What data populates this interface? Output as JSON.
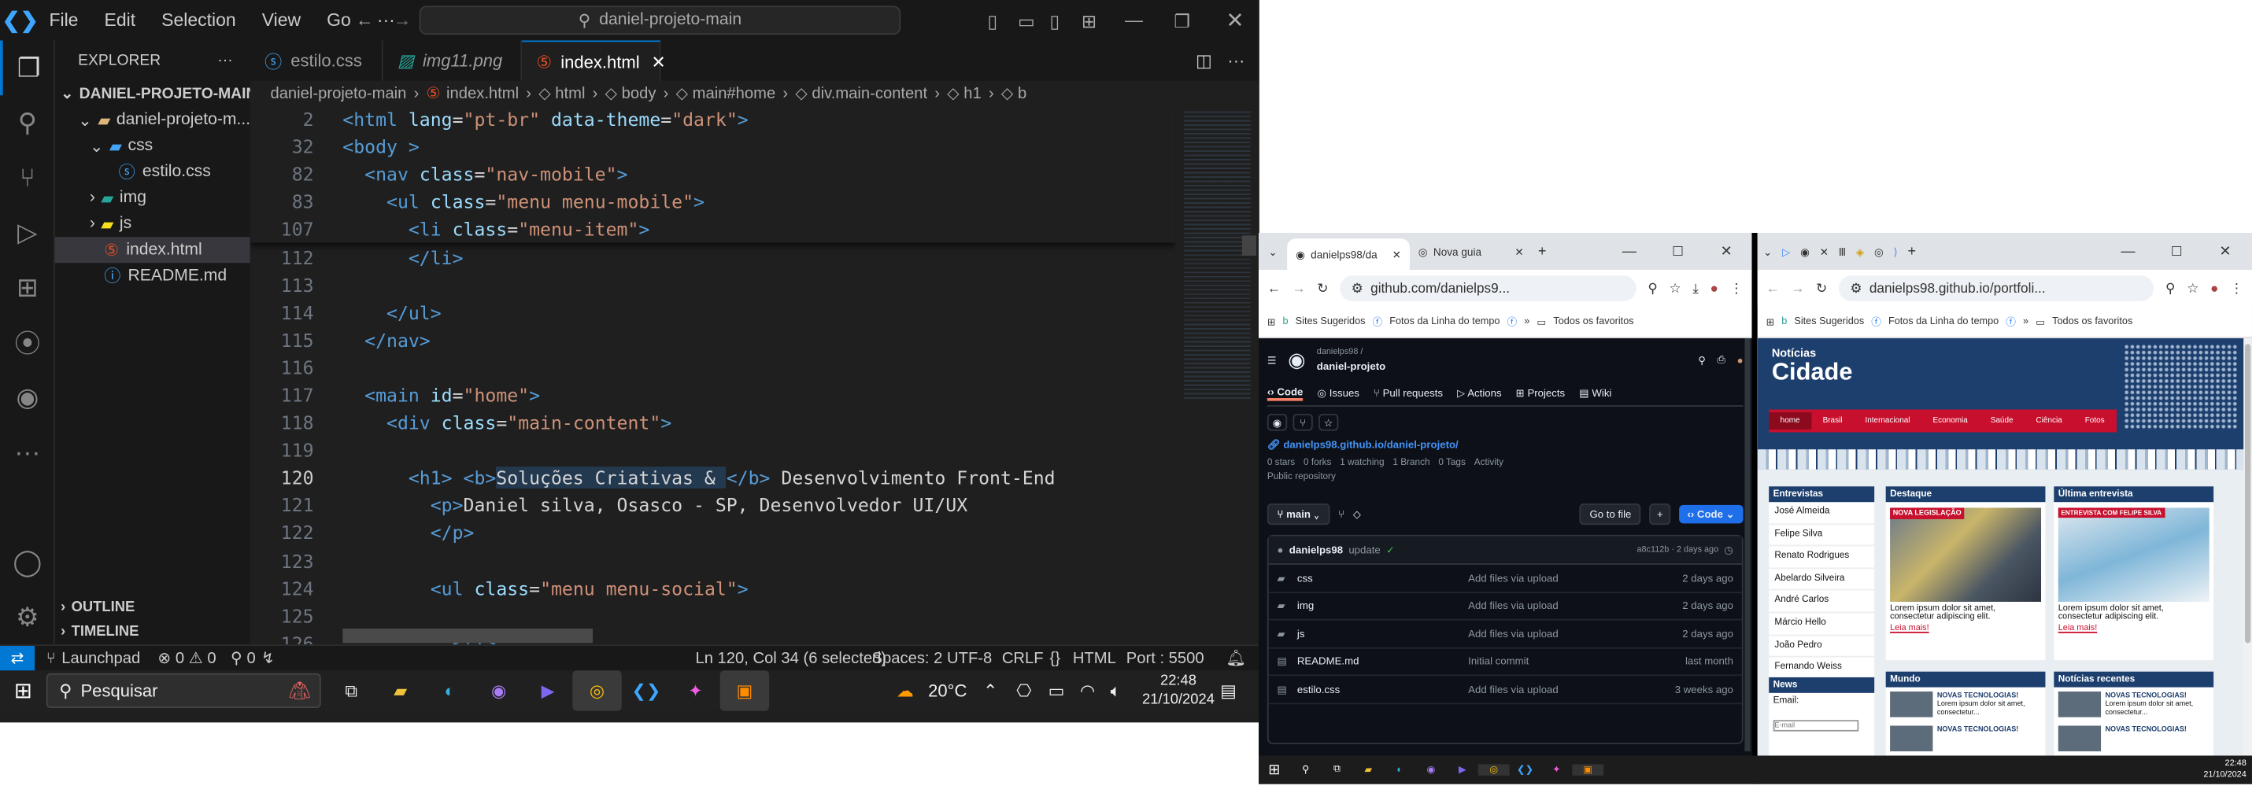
{
  "vscode": {
    "menu": [
      "File",
      "Edit",
      "Selection",
      "View",
      "Go",
      "···"
    ],
    "command_center": "daniel-projeto-main",
    "explorer_title": "EXPLORER",
    "project": "DANIEL-PROJETO-MAIN",
    "tree": [
      {
        "label": "daniel-projeto-m...",
        "level": 1,
        "type": "folder"
      },
      {
        "label": "css",
        "level": 2,
        "type": "folder"
      },
      {
        "label": "estilo.css",
        "level": 3,
        "type": "css"
      },
      {
        "label": "img",
        "level": 2,
        "type": "folder"
      },
      {
        "label": "js",
        "level": 2,
        "type": "folder"
      },
      {
        "label": "index.html",
        "level": 2,
        "type": "html"
      },
      {
        "label": "README.md",
        "level": 2,
        "type": "md"
      }
    ],
    "outline": "OUTLINE",
    "timeline": "TIMELINE",
    "tabs": [
      {
        "label": "estilo.css"
      },
      {
        "label": "img11.png"
      },
      {
        "label": "index.html"
      }
    ],
    "breadcrumb": [
      "daniel-projeto-main",
      "index.html",
      "html",
      "body",
      "main#home",
      "div.main-content",
      "h1",
      "b"
    ],
    "sticky": [
      {
        "n": "2",
        "code": [
          [
            "kw",
            "<html "
          ],
          [
            "at",
            "lang"
          ],
          [
            "tx",
            "="
          ],
          [
            "st",
            "\"pt-br\" "
          ],
          [
            "at",
            "data-theme"
          ],
          [
            "tx",
            "="
          ],
          [
            "st",
            "\"dark\""
          ],
          [
            "kw",
            ">"
          ]
        ]
      },
      {
        "n": "32",
        "code": [
          [
            "kw",
            "<body "
          ],
          [
            "kw",
            ">"
          ]
        ]
      },
      {
        "n": "82",
        "code": [
          [
            "tx",
            "  "
          ],
          [
            "kw",
            "<nav "
          ],
          [
            "at",
            "class"
          ],
          [
            "tx",
            "="
          ],
          [
            "st",
            "\"nav-mobile\""
          ],
          [
            "kw",
            ">"
          ]
        ]
      },
      {
        "n": "83",
        "code": [
          [
            "tx",
            "    "
          ],
          [
            "kw",
            "<ul "
          ],
          [
            "at",
            "class"
          ],
          [
            "tx",
            "="
          ],
          [
            "st",
            "\"menu menu-mobile\""
          ],
          [
            "kw",
            ">"
          ]
        ]
      },
      {
        "n": "107",
        "code": [
          [
            "tx",
            "      "
          ],
          [
            "kw",
            "<li "
          ],
          [
            "at",
            "class"
          ],
          [
            "tx",
            "="
          ],
          [
            "st",
            "\"menu-item\""
          ],
          [
            "kw",
            ">"
          ]
        ]
      }
    ],
    "lines": [
      {
        "n": "112",
        "code": [
          [
            "tx",
            "      "
          ],
          [
            "kw",
            "</li>"
          ]
        ]
      },
      {
        "n": "113",
        "code": []
      },
      {
        "n": "114",
        "code": [
          [
            "tx",
            "    "
          ],
          [
            "kw",
            "</ul>"
          ]
        ]
      },
      {
        "n": "115",
        "code": [
          [
            "tx",
            "  "
          ],
          [
            "kw",
            "</nav>"
          ]
        ]
      },
      {
        "n": "116",
        "code": []
      },
      {
        "n": "117",
        "code": [
          [
            "tx",
            "  "
          ],
          [
            "kw",
            "<main "
          ],
          [
            "at",
            "id"
          ],
          [
            "tx",
            "="
          ],
          [
            "st",
            "\"home\""
          ],
          [
            "kw",
            ">"
          ]
        ]
      },
      {
        "n": "118",
        "code": [
          [
            "tx",
            "    "
          ],
          [
            "kw",
            "<div "
          ],
          [
            "at",
            "class"
          ],
          [
            "tx",
            "="
          ],
          [
            "st",
            "\"main-content\""
          ],
          [
            "kw",
            ">"
          ]
        ]
      },
      {
        "n": "119",
        "code": []
      },
      {
        "n": "120",
        "code": [
          [
            "tx",
            "      "
          ],
          [
            "kw",
            "<h1> "
          ],
          [
            "kw",
            "<b>"
          ],
          [
            "tx",
            "Soluções Criativas & "
          ],
          [
            "kw",
            "</b>"
          ],
          [
            "tx",
            " Desenvolvimento Front-End"
          ]
        ]
      },
      {
        "n": "121",
        "code": [
          [
            "tx",
            "        "
          ],
          [
            "kw",
            "<p>"
          ],
          [
            "tx",
            "Daniel silva, Osasco - SP, Desenvolvedor UI/UX"
          ]
        ]
      },
      {
        "n": "122",
        "code": [
          [
            "tx",
            "        "
          ],
          [
            "kw",
            "</p>"
          ]
        ]
      },
      {
        "n": "123",
        "code": []
      },
      {
        "n": "124",
        "code": [
          [
            "tx",
            "        "
          ],
          [
            "kw",
            "<ul "
          ],
          [
            "at",
            "class"
          ],
          [
            "tx",
            "="
          ],
          [
            "st",
            "\"menu menu-social\""
          ],
          [
            "kw",
            ">"
          ]
        ]
      },
      {
        "n": "125",
        "code": []
      },
      {
        "n": "126",
        "code": [
          [
            "tx",
            "          "
          ],
          [
            "kw",
            "<li>"
          ]
        ]
      }
    ],
    "status": {
      "remote": "⇄",
      "branch": "Launchpad",
      "problems": "⊗ 0 ⚠ 0",
      "ports": "⚲ 0",
      "cursor": "Ln 120, Col 34 (6 selected)",
      "spaces": "Spaces: 2",
      "encoding": "UTF-8",
      "eol": "CRLF",
      "lang": "HTML",
      "port": "Port : 5500"
    }
  },
  "taskbar": {
    "search": "Pesquisar",
    "weather": "20°C",
    "time": "22:48",
    "date": "21/10/2024"
  },
  "chrome_left": {
    "tabs": [
      "danielps98/da",
      "Nova guia"
    ],
    "url": "github.com/danielps9...",
    "bookmarks": [
      "Sites Sugeridos",
      "Fotos da Linha do tempo",
      "Todos os favoritos"
    ],
    "repo_owner": "danielps98 /",
    "repo_name": "daniel-projeto",
    "nav": [
      "Code",
      "Issues",
      "Pull requests",
      "Actions",
      "Projects",
      "Wiki"
    ],
    "link": "danielps98.github.io/daniel-projeto/",
    "stats": [
      "0 stars",
      "0 forks",
      "1 watching",
      "1 Branch",
      "0 Tags",
      "Activity"
    ],
    "visibility": "Public repository",
    "branch": "main",
    "goto": "Go to file",
    "code_btn": "Code",
    "commit_user": "danielps98",
    "commit_msg": "update",
    "commit_meta": "a8c112b · 2 days ago",
    "files": [
      {
        "name": "css",
        "msg": "Add files via upload",
        "time": "2 days ago",
        "type": "dir"
      },
      {
        "name": "img",
        "msg": "Add files via upload",
        "time": "2 days ago",
        "type": "dir"
      },
      {
        "name": "js",
        "msg": "Add files via upload",
        "time": "2 days ago",
        "type": "dir"
      },
      {
        "name": "README.md",
        "msg": "Initial commit",
        "time": "last month",
        "type": "file"
      },
      {
        "name": "estilo.css",
        "msg": "Add files via upload",
        "time": "3 weeks ago",
        "type": "file"
      }
    ]
  },
  "chrome_right": {
    "url": "danielps98.github.io/portfoli...",
    "bookmarks": [
      "Sites Sugeridos",
      "Fotos da Linha do tempo",
      "Todos os favoritos"
    ],
    "logo_top": "Notícias",
    "logo_bottom": "Cidade",
    "nav": [
      "home",
      "Brasil",
      "Internacional",
      "Economia",
      "Saúde",
      "Ciência",
      "Fotos"
    ],
    "entrevistas_title": "Entrevistas",
    "entrevistas": [
      "José Almeida",
      "Felipe Silva",
      "Renato Rodrigues",
      "Abelardo Silveira",
      "André Carlos",
      "Márcio Hello",
      "João Pedro",
      "Fernando Weiss"
    ],
    "news_title": "News",
    "email_label": "Email:",
    "email_placeholder": "E-mail",
    "destaque_title": "Destaque",
    "destaque_tag": "NOVA LEGISLAÇÃO",
    "destaque_text": "Lorem ipsum dolor sit amet, consectetur adipiscing elit.",
    "leia": "Leia mais!",
    "ultima_title": "Última entrevista",
    "ultima_tag": "ENTREVISTA COM FELIPE SILVA",
    "ultima_text": "Lorem ipsum dolor sit amet, consectetur adipiscing elit.",
    "mundo_title": "Mundo",
    "recentes_title": "Notícias recentes",
    "mini_tag": "NOVAS TECNOLOGIAS!",
    "mini_text": "Lorem ipsum dolor sit amet, consectetur..."
  },
  "taskbar2": {
    "time": "22:48",
    "date": "21/10/2024"
  }
}
